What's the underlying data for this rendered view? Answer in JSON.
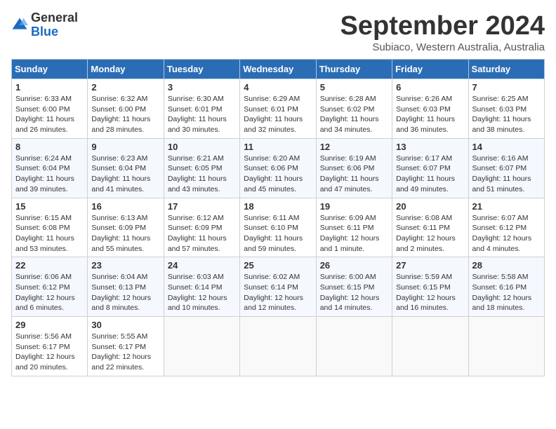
{
  "logo": {
    "general": "General",
    "blue": "Blue"
  },
  "title": {
    "month_year": "September 2024",
    "location": "Subiaco, Western Australia, Australia"
  },
  "days_of_week": [
    "Sunday",
    "Monday",
    "Tuesday",
    "Wednesday",
    "Thursday",
    "Friday",
    "Saturday"
  ],
  "weeks": [
    [
      {
        "day": "1",
        "info": "Sunrise: 6:33 AM\nSunset: 6:00 PM\nDaylight: 11 hours\nand 26 minutes."
      },
      {
        "day": "2",
        "info": "Sunrise: 6:32 AM\nSunset: 6:00 PM\nDaylight: 11 hours\nand 28 minutes."
      },
      {
        "day": "3",
        "info": "Sunrise: 6:30 AM\nSunset: 6:01 PM\nDaylight: 11 hours\nand 30 minutes."
      },
      {
        "day": "4",
        "info": "Sunrise: 6:29 AM\nSunset: 6:01 PM\nDaylight: 11 hours\nand 32 minutes."
      },
      {
        "day": "5",
        "info": "Sunrise: 6:28 AM\nSunset: 6:02 PM\nDaylight: 11 hours\nand 34 minutes."
      },
      {
        "day": "6",
        "info": "Sunrise: 6:26 AM\nSunset: 6:03 PM\nDaylight: 11 hours\nand 36 minutes."
      },
      {
        "day": "7",
        "info": "Sunrise: 6:25 AM\nSunset: 6:03 PM\nDaylight: 11 hours\nand 38 minutes."
      }
    ],
    [
      {
        "day": "8",
        "info": "Sunrise: 6:24 AM\nSunset: 6:04 PM\nDaylight: 11 hours\nand 39 minutes."
      },
      {
        "day": "9",
        "info": "Sunrise: 6:23 AM\nSunset: 6:04 PM\nDaylight: 11 hours\nand 41 minutes."
      },
      {
        "day": "10",
        "info": "Sunrise: 6:21 AM\nSunset: 6:05 PM\nDaylight: 11 hours\nand 43 minutes."
      },
      {
        "day": "11",
        "info": "Sunrise: 6:20 AM\nSunset: 6:06 PM\nDaylight: 11 hours\nand 45 minutes."
      },
      {
        "day": "12",
        "info": "Sunrise: 6:19 AM\nSunset: 6:06 PM\nDaylight: 11 hours\nand 47 minutes."
      },
      {
        "day": "13",
        "info": "Sunrise: 6:17 AM\nSunset: 6:07 PM\nDaylight: 11 hours\nand 49 minutes."
      },
      {
        "day": "14",
        "info": "Sunrise: 6:16 AM\nSunset: 6:07 PM\nDaylight: 11 hours\nand 51 minutes."
      }
    ],
    [
      {
        "day": "15",
        "info": "Sunrise: 6:15 AM\nSunset: 6:08 PM\nDaylight: 11 hours\nand 53 minutes."
      },
      {
        "day": "16",
        "info": "Sunrise: 6:13 AM\nSunset: 6:09 PM\nDaylight: 11 hours\nand 55 minutes."
      },
      {
        "day": "17",
        "info": "Sunrise: 6:12 AM\nSunset: 6:09 PM\nDaylight: 11 hours\nand 57 minutes."
      },
      {
        "day": "18",
        "info": "Sunrise: 6:11 AM\nSunset: 6:10 PM\nDaylight: 11 hours\nand 59 minutes."
      },
      {
        "day": "19",
        "info": "Sunrise: 6:09 AM\nSunset: 6:11 PM\nDaylight: 12 hours\nand 1 minute."
      },
      {
        "day": "20",
        "info": "Sunrise: 6:08 AM\nSunset: 6:11 PM\nDaylight: 12 hours\nand 2 minutes."
      },
      {
        "day": "21",
        "info": "Sunrise: 6:07 AM\nSunset: 6:12 PM\nDaylight: 12 hours\nand 4 minutes."
      }
    ],
    [
      {
        "day": "22",
        "info": "Sunrise: 6:06 AM\nSunset: 6:12 PM\nDaylight: 12 hours\nand 6 minutes."
      },
      {
        "day": "23",
        "info": "Sunrise: 6:04 AM\nSunset: 6:13 PM\nDaylight: 12 hours\nand 8 minutes."
      },
      {
        "day": "24",
        "info": "Sunrise: 6:03 AM\nSunset: 6:14 PM\nDaylight: 12 hours\nand 10 minutes."
      },
      {
        "day": "25",
        "info": "Sunrise: 6:02 AM\nSunset: 6:14 PM\nDaylight: 12 hours\nand 12 minutes."
      },
      {
        "day": "26",
        "info": "Sunrise: 6:00 AM\nSunset: 6:15 PM\nDaylight: 12 hours\nand 14 minutes."
      },
      {
        "day": "27",
        "info": "Sunrise: 5:59 AM\nSunset: 6:15 PM\nDaylight: 12 hours\nand 16 minutes."
      },
      {
        "day": "28",
        "info": "Sunrise: 5:58 AM\nSunset: 6:16 PM\nDaylight: 12 hours\nand 18 minutes."
      }
    ],
    [
      {
        "day": "29",
        "info": "Sunrise: 5:56 AM\nSunset: 6:17 PM\nDaylight: 12 hours\nand 20 minutes."
      },
      {
        "day": "30",
        "info": "Sunrise: 5:55 AM\nSunset: 6:17 PM\nDaylight: 12 hours\nand 22 minutes."
      },
      null,
      null,
      null,
      null,
      null
    ]
  ]
}
